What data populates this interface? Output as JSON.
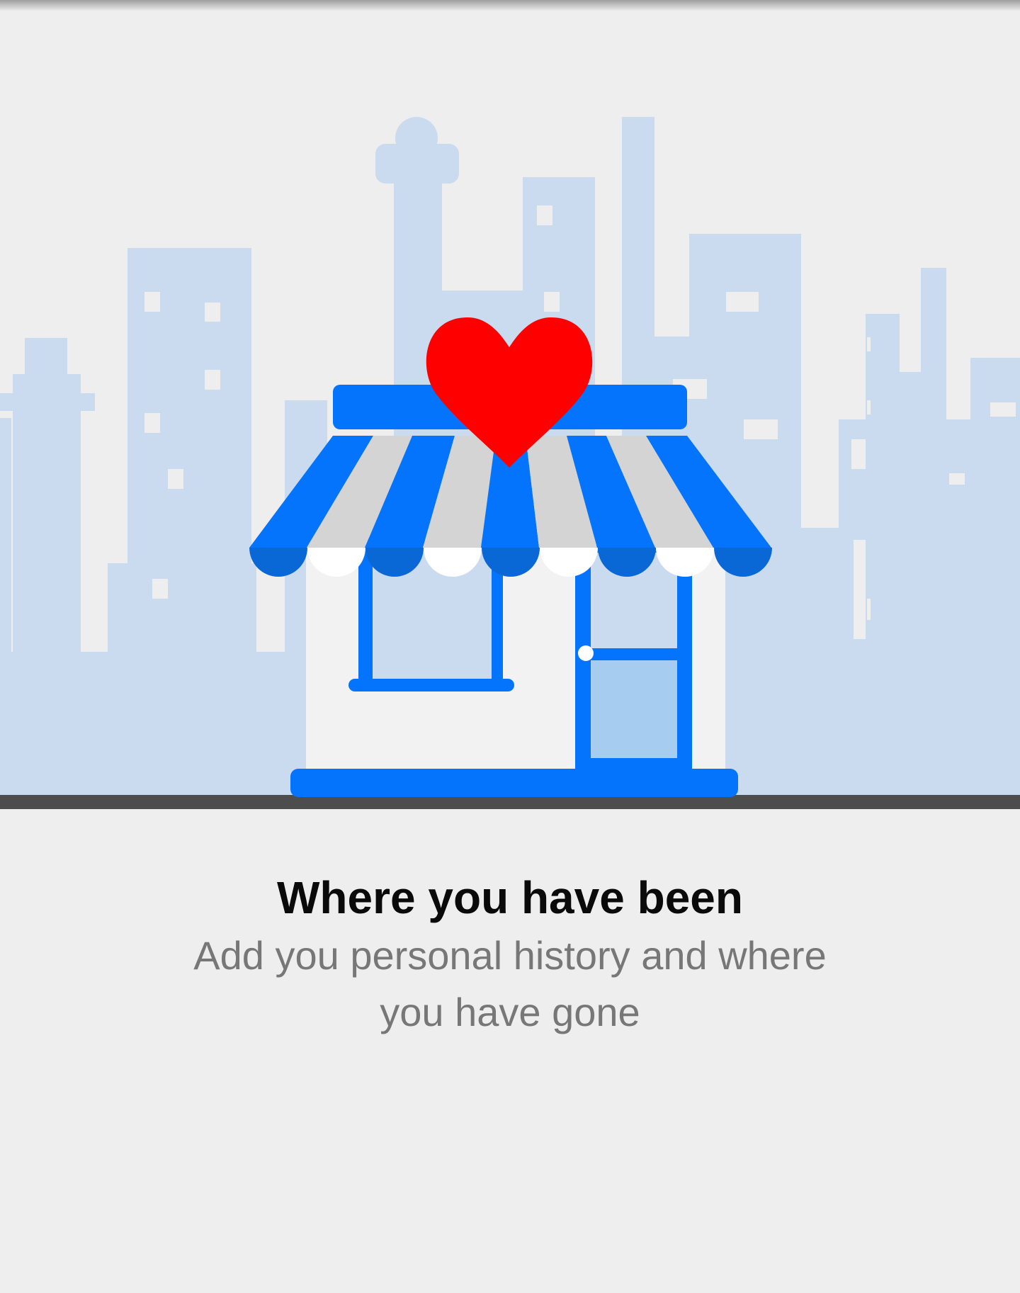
{
  "colors": {
    "background": "#eeeeee",
    "skyline": "#cbdbef",
    "brand_blue": "#0574fc",
    "awning_gray": "#d4d4d4",
    "heart_red": "#ff0000",
    "ground": "#4d4d4d",
    "title_text": "#0a0a0a",
    "subtitle_text": "#777777"
  },
  "illustration": {
    "icons": [
      "city-skyline-icon",
      "storefront-icon",
      "heart-icon"
    ]
  },
  "onboarding": {
    "title": "Where you have been",
    "subtitle": "Add you personal history and where you have gone"
  }
}
